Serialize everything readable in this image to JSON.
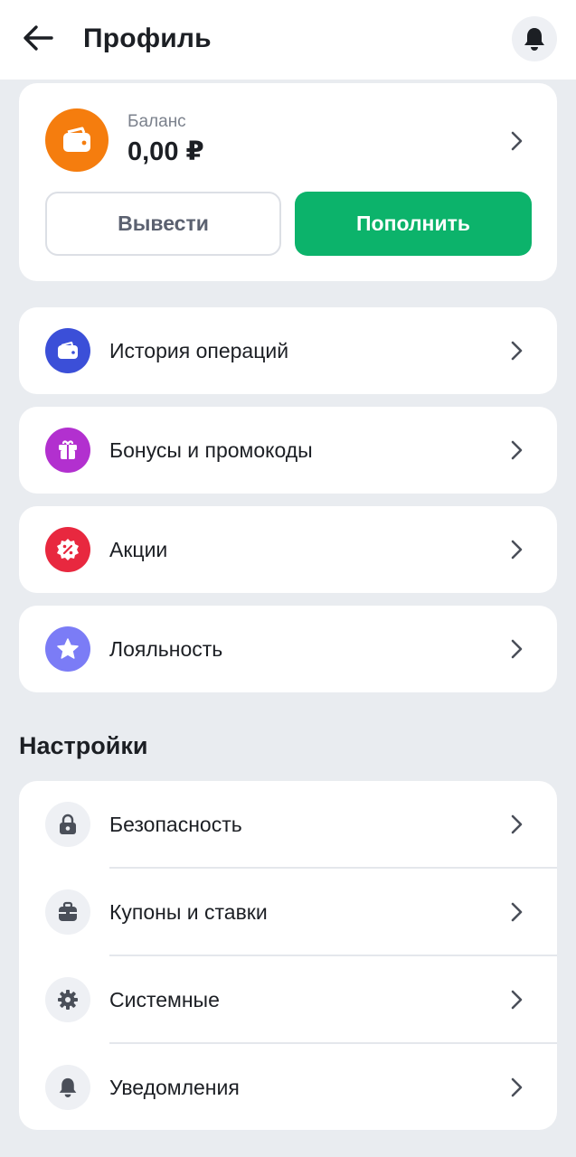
{
  "header": {
    "title": "Профиль",
    "back_icon": "arrow-left-icon",
    "bell_icon": "bell-icon"
  },
  "balance": {
    "label": "Баланс",
    "value": "0,00 ₽",
    "icon": "wallet-icon",
    "icon_color": "#f57d0e",
    "withdraw_label": "Вывести",
    "deposit_label": "Пополнить",
    "deposit_color": "#0cb36b"
  },
  "menu": {
    "items": [
      {
        "label": "История операций",
        "icon": "wallet-icon",
        "color": "#3b4fd8"
      },
      {
        "label": "Бонусы и промокоды",
        "icon": "gift-icon",
        "color": "#b230cf"
      },
      {
        "label": "Акции",
        "icon": "percent-badge-icon",
        "color": "#e8283f"
      },
      {
        "label": "Лояльность",
        "icon": "star-icon",
        "color": "#7b7cf6"
      }
    ]
  },
  "settings": {
    "title": "Настройки",
    "items": [
      {
        "label": "Безопасность",
        "icon": "lock-icon"
      },
      {
        "label": "Купоны и ставки",
        "icon": "briefcase-icon"
      },
      {
        "label": "Системные",
        "icon": "gear-icon"
      },
      {
        "label": "Уведомления",
        "icon": "bell-icon"
      }
    ]
  }
}
